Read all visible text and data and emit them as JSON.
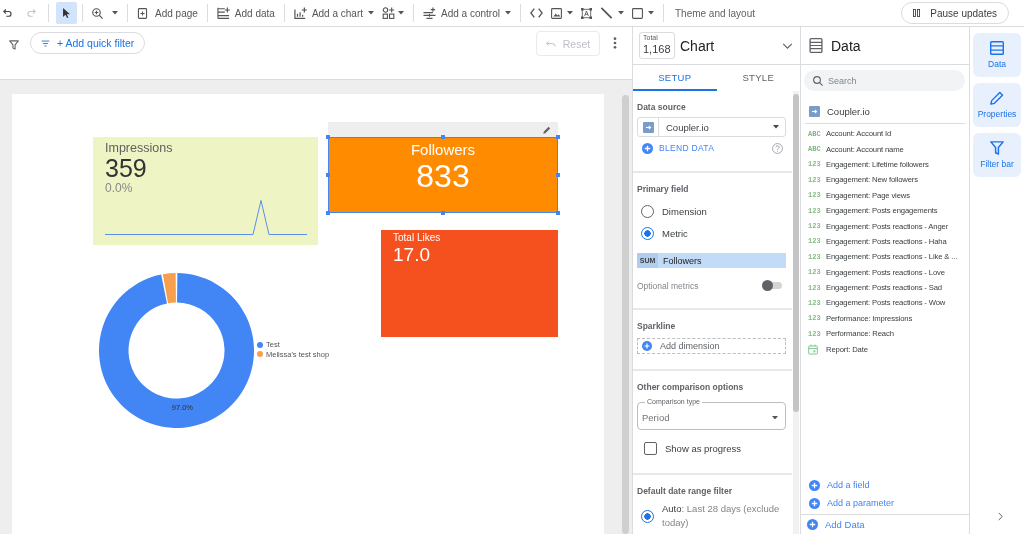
{
  "toolbar": {
    "history": [
      {
        "kind": "undo",
        "disabled": false
      },
      {
        "kind": "redo",
        "disabled": true
      }
    ],
    "pointer": {
      "selected": true
    },
    "groups": [
      {
        "tools": [
          {
            "kind": "zoom",
            "menu": true
          }
        ]
      },
      {
        "tools": [
          {
            "kind": "add-page",
            "label": "Add page",
            "menu": false
          }
        ]
      },
      {
        "tools": [
          {
            "kind": "add-data",
            "label": "Add data",
            "menu": false
          }
        ]
      },
      {
        "tools": [
          {
            "kind": "add-chart",
            "label": "Add a chart",
            "menu": true
          },
          {
            "kind": "components",
            "menu": true
          }
        ]
      },
      {
        "tools": [
          {
            "kind": "add-control",
            "label": "Add a control",
            "menu": true
          }
        ]
      },
      {
        "tools": [
          {
            "kind": "code",
            "menu": false
          },
          {
            "kind": "image",
            "menu": true
          },
          {
            "kind": "text-box",
            "menu": false
          },
          {
            "kind": "line",
            "menu": true
          },
          {
            "kind": "shape",
            "menu": true
          }
        ]
      },
      {
        "tools": [
          {
            "kind": "theme",
            "label": "Theme and layout",
            "menu": false
          }
        ]
      }
    ],
    "pause_button": {
      "label": "Pause updates"
    }
  },
  "filter_bar": {
    "quick_filter": "+ Add quick filter",
    "reset": {
      "label": "Reset",
      "disabled": true
    }
  },
  "canvas": {
    "cards": [
      {
        "kind": "sparkline",
        "title": "Impressions",
        "value": "359",
        "delta": "0.0%",
        "color": "#eef4c4",
        "selected": false
      },
      {
        "kind": "centered",
        "title": "Followers",
        "value": "833",
        "color": "#ff8c00",
        "selected": true
      },
      {
        "kind": "compact",
        "title": "Total Likes",
        "value": "17.0",
        "color": "#f4511e",
        "selected": false
      }
    ],
    "donut": {
      "chart_data": {
        "type": "donut",
        "categories": [
          "Test",
          "Melissa's test shop"
        ],
        "values": [
          97.0,
          3.0
        ],
        "colors": [
          "#4285f4",
          "#f6a04d"
        ],
        "value_labels": [
          "97.0%",
          null
        ],
        "legend": "right"
      }
    }
  },
  "chart_panel": {
    "header": {
      "total_label": "Total",
      "total_value": "1,168",
      "title": "Chart"
    },
    "tabs": [
      {
        "label": "SETUP",
        "selected": true
      },
      {
        "label": "STYLE",
        "selected": false
      }
    ],
    "data_source": {
      "heading": "Data source",
      "source": "Coupler.io",
      "blend": "BLEND DATA"
    },
    "primary_field": {
      "heading": "Primary field",
      "options": [
        {
          "label": "Dimension",
          "selected": false
        },
        {
          "label": "Metric",
          "selected": true
        }
      ],
      "metric": {
        "aggregation": "SUM",
        "name": "Followers"
      },
      "optional_metrics": {
        "label": "Optional metrics",
        "on": false
      }
    },
    "sparkline": {
      "heading": "Sparkline",
      "add_label": "Add dimension"
    },
    "comparison": {
      "heading": "Other comparison options",
      "select": {
        "label": "Comparison type",
        "value": "Period"
      },
      "progress": {
        "label": "Show as progress",
        "checked": false
      }
    },
    "date_range": {
      "heading": "Default date range filter",
      "options": [
        {
          "label": "Auto",
          "detail": ": Last 28 days (exclude today)",
          "selected": true
        }
      ]
    }
  },
  "data_panel": {
    "title": "Data",
    "search": {
      "placeholder": "Search"
    },
    "source": "Coupler.io",
    "fields": [
      {
        "kind": "text",
        "type_label": "ABC",
        "name": "Account: Account Id"
      },
      {
        "kind": "text",
        "type_label": "ABC",
        "name": "Account: Account name"
      },
      {
        "kind": "number",
        "type_label": "123",
        "name": "Engagement: Lifetime followers"
      },
      {
        "kind": "number",
        "type_label": "123",
        "name": "Engagement: New followers"
      },
      {
        "kind": "number",
        "type_label": "123",
        "name": "Engagement: Page views"
      },
      {
        "kind": "number",
        "type_label": "123",
        "name": "Engagement: Posts engagements"
      },
      {
        "kind": "number",
        "type_label": "123",
        "name": "Engagement: Posts reactions - Anger"
      },
      {
        "kind": "number",
        "type_label": "123",
        "name": "Engagement: Posts reactions - Haha"
      },
      {
        "kind": "number",
        "type_label": "123",
        "name": "Engagement: Posts reactions - Like & ..."
      },
      {
        "kind": "number",
        "type_label": "123",
        "name": "Engagement: Posts reactions - Love"
      },
      {
        "kind": "number",
        "type_label": "123",
        "name": "Engagement: Posts reactions - Sad"
      },
      {
        "kind": "number",
        "type_label": "123",
        "name": "Engagement: Posts reactions - Wow"
      },
      {
        "kind": "number",
        "type_label": "123",
        "name": "Performance: Impressions"
      },
      {
        "kind": "number",
        "type_label": "123",
        "name": "Performance: Reach"
      },
      {
        "kind": "date",
        "name": "Report: Date"
      }
    ],
    "actions": [
      {
        "label": "Add a field"
      },
      {
        "label": "Add a parameter"
      }
    ],
    "add_data": "Add Data"
  },
  "rail": [
    {
      "kind": "data",
      "label": "Data"
    },
    {
      "kind": "properties",
      "label": "Properties"
    },
    {
      "kind": "filter",
      "label": "Filter bar"
    }
  ]
}
